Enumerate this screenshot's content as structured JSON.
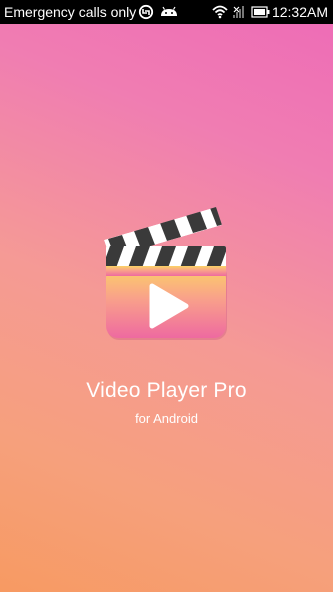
{
  "status_bar": {
    "carrier_text": "Emergency calls only",
    "time": "12:32AM",
    "icons": [
      "sync-icon",
      "android-icon",
      "wifi-icon",
      "no-signal-icon",
      "battery-icon"
    ]
  },
  "splash": {
    "logo_icon": "clapperboard-play-icon",
    "title": "Video Player Pro",
    "subtitle": "for Android"
  },
  "colors": {
    "background_top": "#ee6db6",
    "background_bottom": "#f79a62",
    "status_bar": "#000000",
    "text": "#ffffff"
  }
}
